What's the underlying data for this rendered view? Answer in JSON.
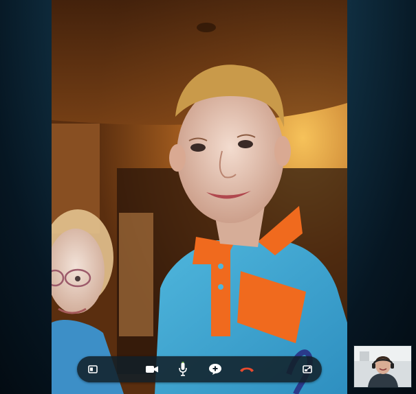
{
  "call": {
    "controls": [
      {
        "name": "toggle-sidebar-button",
        "icon": "panel-icon"
      },
      {
        "name": "video-button",
        "icon": "video-camera-icon"
      },
      {
        "name": "microphone-button",
        "icon": "microphone-icon"
      },
      {
        "name": "add-to-call-button",
        "icon": "chat-plus-icon"
      },
      {
        "name": "end-call-button",
        "icon": "hang-up-icon",
        "color": "#e84a2e"
      },
      {
        "name": "fullscreen-button",
        "icon": "expand-icon"
      }
    ],
    "self_view": {
      "icon": "self-camera-preview"
    },
    "remote_video": {
      "icon": "remote-camera-feed"
    }
  },
  "colors": {
    "background": "#0b2434",
    "control_bar": "#12202a",
    "icon": "#ffffff",
    "end_call": "#e84a2e",
    "mic_level": "#7fc24a"
  }
}
